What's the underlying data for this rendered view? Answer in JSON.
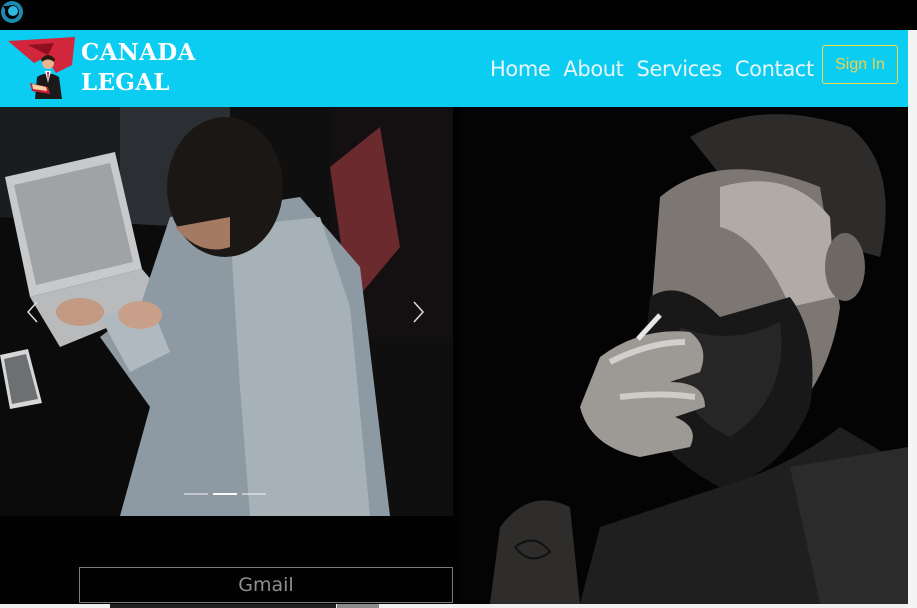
{
  "app": {
    "icon": "refresh-icon"
  },
  "brand": {
    "line1": "CANADA",
    "line2": "LEGAL",
    "logo_icon": "lawyer-logo"
  },
  "nav": {
    "links": [
      {
        "label": "Home"
      },
      {
        "label": "About"
      },
      {
        "label": "Services"
      },
      {
        "label": "Contact"
      }
    ],
    "signin_label": "Sign In"
  },
  "hero": {
    "left_image": "man-working-on-laptop",
    "right_image": "bearded-man-smoking",
    "prev_icon": "chevron-left-icon",
    "next_icon": "chevron-right-icon",
    "active_indicator": 2,
    "indicator_count": 3
  },
  "actions": {
    "gmail_label": "Gmail"
  },
  "colors": {
    "navbar": "#0bcdf2",
    "signin": "#f1d04a",
    "page": "#020203"
  }
}
